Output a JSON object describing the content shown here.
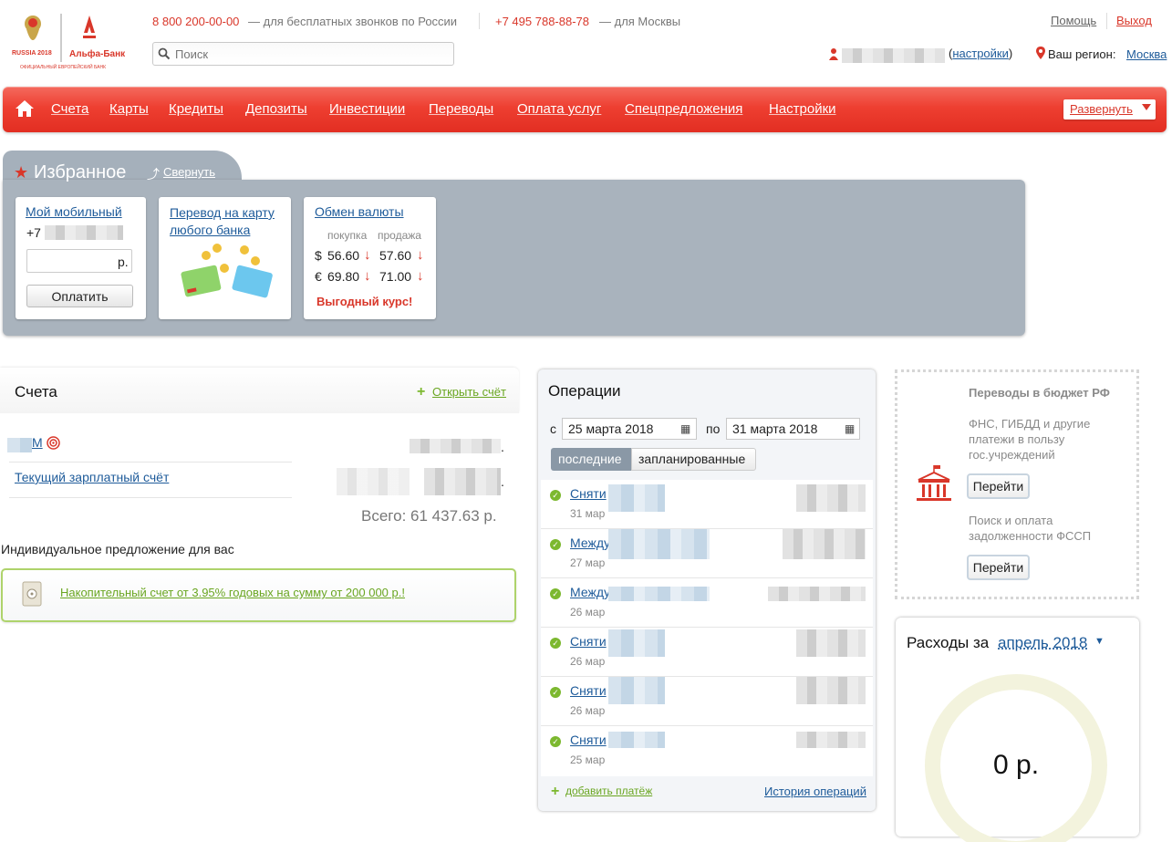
{
  "header": {
    "logo_bank": "Альфа-Банк",
    "logo_sub": "ОФИЦИАЛЬНЫЙ ЕВРОПЕЙСКИЙ БАНК",
    "logo_event": "RUSSIA 2018",
    "phone_free": "8 800 200-00-00",
    "phone_free_desc": "— для бесплатных звонков по России",
    "phone_moscow": "+7 495 788-88-78",
    "phone_moscow_desc": "— для Москвы",
    "help": "Помощь",
    "logout": "Выход",
    "search_placeholder": "Поиск",
    "settings": "настройки",
    "region_label": "Ваш регион:",
    "region_value": "Москва"
  },
  "nav": {
    "items": [
      "Счета",
      "Карты",
      "Кредиты",
      "Депозиты",
      "Инвестиции",
      "Переводы",
      "Оплата услуг",
      "Спецпредложения",
      "Настройки"
    ],
    "expand": "Развернуть"
  },
  "favorites": {
    "title": "Избранное",
    "collapse": "Свернуть",
    "mobile": {
      "title": "Мой мобильный",
      "phone_prefix": "+7 9",
      "currency": "р.",
      "pay_button": "Оплатить"
    },
    "transfer": {
      "title": "Перевод на карту любого банка"
    },
    "exchange": {
      "title": "Обмен валюты",
      "buy_label": "покупка",
      "sell_label": "продажа",
      "rates": [
        {
          "symbol": "$",
          "buy": "56.60",
          "sell": "57.60"
        },
        {
          "symbol": "€",
          "buy": "69.80",
          "sell": "71.00"
        }
      ],
      "promo": "Выгодный курс!"
    }
  },
  "accounts": {
    "title": "Счета",
    "open_account": "Открыть счёт",
    "items": [
      {
        "name_suffix": "М",
        "amount_suffix": "."
      },
      {
        "name": "Текущий зарплатный счёт",
        "amount_suffix": "."
      }
    ],
    "total": "Всего: 61 437.63 р.",
    "offer_title": "Индивидуальное предложение для вас",
    "offer_text": "Накопительный счет от 3.95% годовых на сумму от 200 000 р.!"
  },
  "operations": {
    "title": "Операции",
    "from_label": "с",
    "from_date": "25 марта 2018",
    "to_label": "по",
    "to_date": "31 марта 2018",
    "tabs": [
      "последние",
      "запланированные"
    ],
    "rows": [
      {
        "name": "Сняти",
        "date": "31 мар"
      },
      {
        "name": "Между",
        "date": "27 мар"
      },
      {
        "name": "Между",
        "date": "26 мар"
      },
      {
        "name": "Сняти",
        "date": "26 мар"
      },
      {
        "name": "Сняти",
        "date": "26 мар"
      },
      {
        "name": "Сняти",
        "date": "25 мар"
      }
    ],
    "add_payment": "добавить платёж",
    "history": "История операций"
  },
  "budget": {
    "title": "Переводы в бюджет РФ",
    "desc": "ФНС, ГИБДД и другие платежи в пользу гос.учреждений",
    "go1": "Перейти",
    "desc2": "Поиск и оплата задолженности ФССП",
    "go2": "Перейти"
  },
  "expenses": {
    "title": "Расходы за",
    "month": "апрель 2018",
    "value": "0 р."
  }
}
